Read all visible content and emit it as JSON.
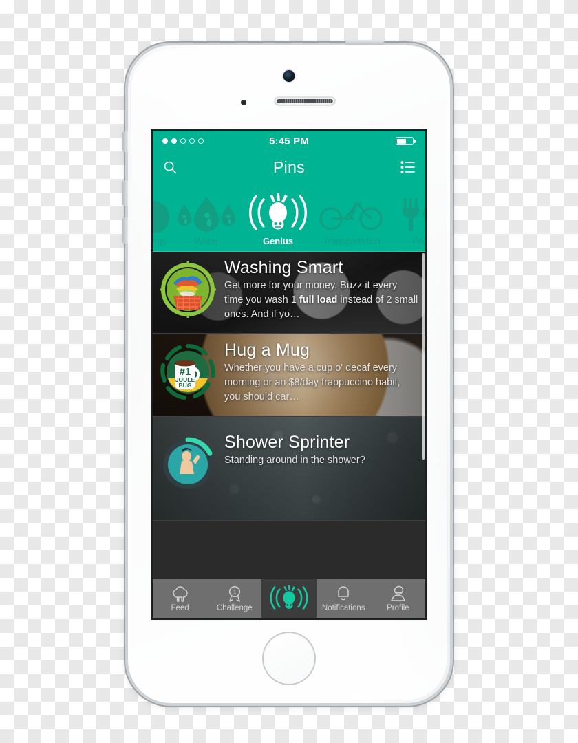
{
  "device": {
    "name": "iphone-5s-white"
  },
  "status_bar": {
    "time": "5:45 PM",
    "signal_dots_total": 5,
    "signal_dots_filled": 2,
    "battery_percent": 62
  },
  "nav_bar": {
    "title": "Pins",
    "search_icon": "search-icon",
    "list_icon": "list-icon"
  },
  "categories": [
    {
      "label": "Energy",
      "icon": "leaf-icon",
      "selected": false,
      "partial": true
    },
    {
      "label": "Water",
      "icon": "water-drops-icon",
      "selected": false,
      "partial": false
    },
    {
      "label": "Genius",
      "icon": "firefly-icon",
      "selected": true,
      "partial": false
    },
    {
      "label": "Transportation",
      "icon": "bicycle-icon",
      "selected": false,
      "partial": false
    },
    {
      "label": "Food",
      "icon": "fork-plate-icon",
      "selected": false,
      "partial": true
    }
  ],
  "feed": [
    {
      "title": "Washing Smart",
      "desc_pre": "Get more for your money. Buzz it every time you wash 1 ",
      "desc_bold": "full load",
      "desc_post": " instead of 2 small ones. And if yo…",
      "badge": "laundry-basket-badge",
      "background": "washing-machines-photo"
    },
    {
      "title": "Hug a Mug",
      "desc_pre": "Whether you have a cup o' decaf every morning or an $8/day frappuccino habit, you should car…",
      "desc_bold": "",
      "desc_post": "",
      "badge": "joule-bug-mug-badge",
      "badge_rank": "#1",
      "badge_line1": "JOULE",
      "badge_line2": "BUG",
      "background": "latte-art-photo"
    },
    {
      "title": "Shower Sprinter",
      "desc_pre": "Standing around in the shower?",
      "desc_bold": "",
      "desc_post": "",
      "badge": "showering-person-badge",
      "background": "rainy-window-photo"
    }
  ],
  "tab_bar": [
    {
      "label": "Feed",
      "icon": "tree-icon",
      "active": false,
      "badge": ""
    },
    {
      "label": "Challenge",
      "icon": "ribbon-icon",
      "active": false,
      "badge": "1"
    },
    {
      "label": "",
      "icon": "firefly-icon",
      "active": true,
      "badge": ""
    },
    {
      "label": "Notifications",
      "icon": "bell-icon",
      "active": false,
      "badge": ""
    },
    {
      "label": "Profile",
      "icon": "person-icon",
      "active": false,
      "badge": ""
    }
  ],
  "colors": {
    "accent_teal": "#00b392",
    "carousel_dim": "#129e83",
    "tabbar_gray": "#6f6f6f",
    "tab_active_bg": "#3c3c3c",
    "tab_active_icon": "#12c9a2"
  }
}
